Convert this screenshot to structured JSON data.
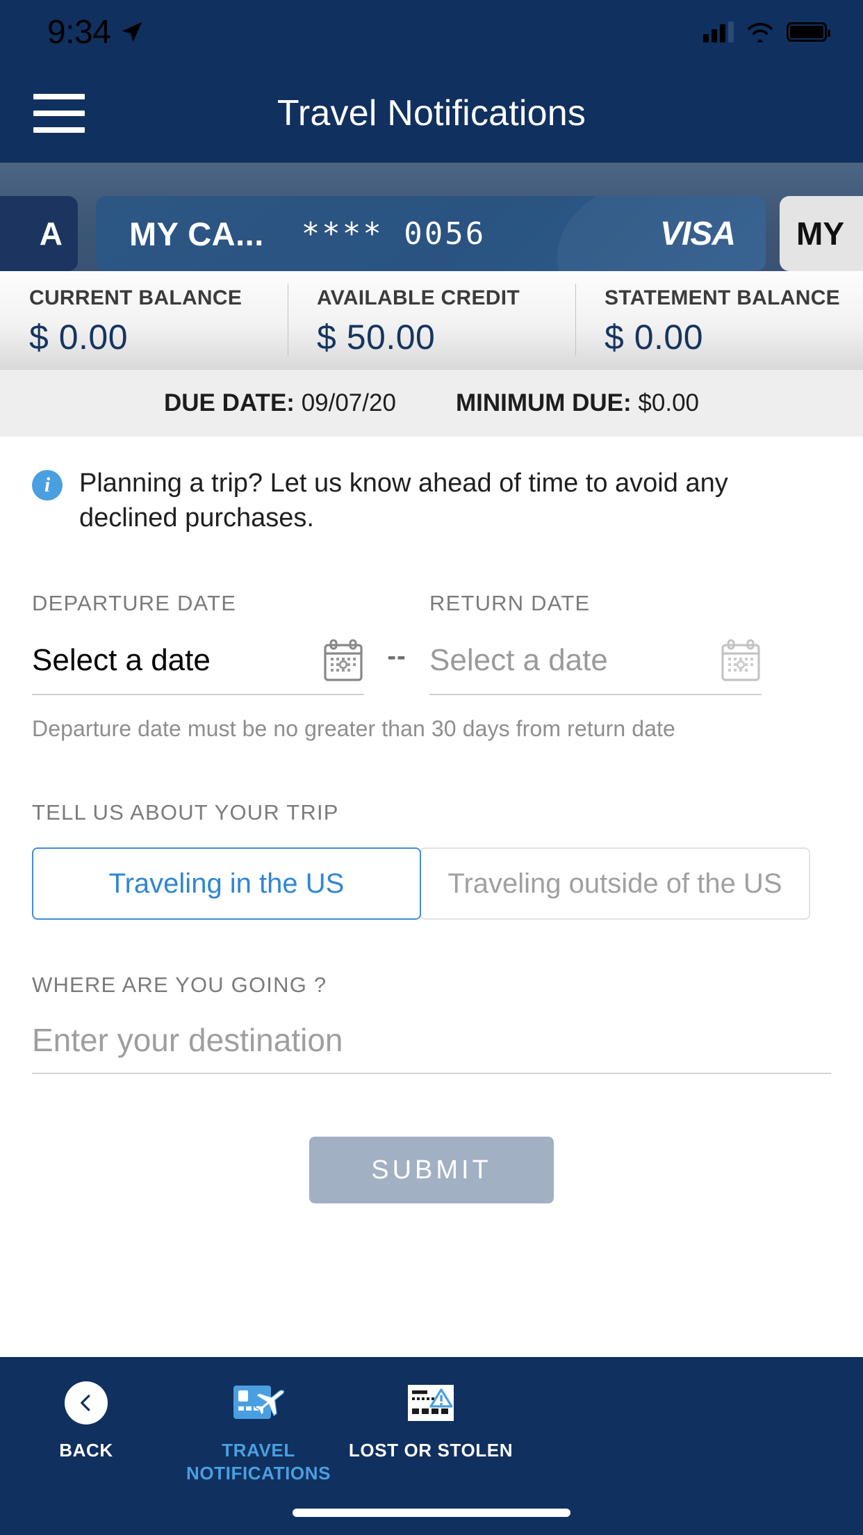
{
  "status_bar": {
    "time": "9:34",
    "location_icon": "location-arrow-icon",
    "signal_icon": "cellular-signal-icon",
    "wifi_icon": "wifi-icon",
    "battery_icon": "battery-full-icon"
  },
  "header": {
    "menu_icon": "hamburger-menu-icon",
    "title": "Travel Notifications"
  },
  "card_carousel": {
    "peek_left_label": "A",
    "peek_right_label": "MY",
    "active_card": {
      "name": "MY CA...",
      "masked_number": "**** 0056",
      "brand": "VISA"
    }
  },
  "balances": [
    {
      "label": "CURRENT BALANCE",
      "value": "$ 0.00"
    },
    {
      "label": "AVAILABLE CREDIT",
      "value": "$ 50.00"
    },
    {
      "label": "STATEMENT BALANCE",
      "value": "$ 0.00"
    }
  ],
  "due_row": {
    "due_date_label": "DUE DATE:",
    "due_date_value": "09/07/20",
    "minimum_due_label": "MINIMUM DUE:",
    "minimum_due_value": "$0.00"
  },
  "info_banner": {
    "icon": "info-circle-icon",
    "text": "Planning a trip? Let us know ahead of time to avoid any declined purchases."
  },
  "dates": {
    "departure_label": "DEPARTURE DATE",
    "departure_value": "Select a date",
    "departure_calendar_icon": "calendar-icon",
    "separator": "--",
    "return_label": "RETURN DATE",
    "return_value": "Select a date",
    "return_calendar_icon": "calendar-icon",
    "helper_text": "Departure date must be no greater than 30 days from return date"
  },
  "trip_type": {
    "label": "TELL US ABOUT YOUR TRIP",
    "option_in_us": "Traveling in the US",
    "option_outside_us": "Traveling outside of the US",
    "selected": "Traveling in the US"
  },
  "destination": {
    "label": "WHERE ARE YOU GOING ?",
    "placeholder": "Enter your destination",
    "value": ""
  },
  "submit": {
    "label": "SUBMIT",
    "enabled": false
  },
  "bottom_nav": [
    {
      "label": "BACK",
      "icon": "chevron-left-circle-icon",
      "active": false
    },
    {
      "label": "TRAVEL NOTIFICATIONS",
      "icon": "card-airplane-icon",
      "active": true
    },
    {
      "label": "LOST OR STOLEN",
      "icon": "card-warning-icon",
      "active": false
    }
  ],
  "colors": {
    "navy": "#10305f",
    "card_blue": "#2d5684",
    "accent_blue": "#2e86d4",
    "info_blue": "#4a9fe0",
    "value_navy": "#16345f",
    "disabled_button": "#a2b0c3"
  }
}
